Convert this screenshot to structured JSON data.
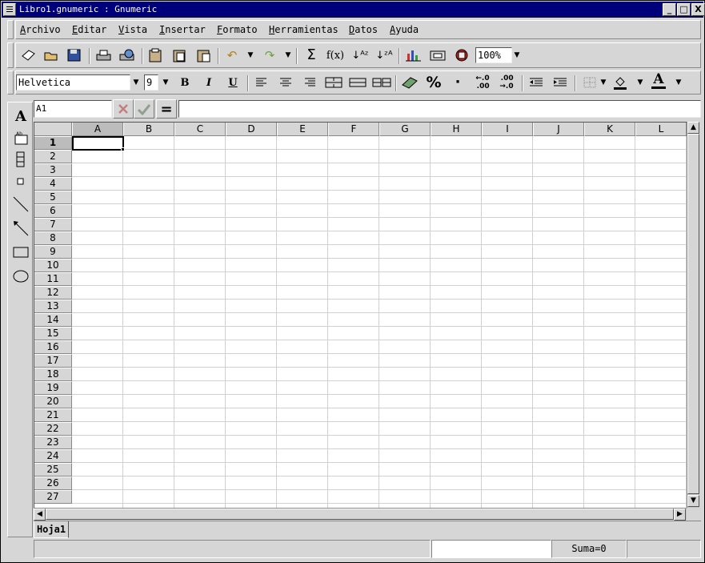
{
  "window": {
    "title": "Libro1.gnumeric : Gnumeric",
    "buttons": [
      "_",
      "□",
      "X"
    ]
  },
  "menubar": [
    {
      "label": "Archivo",
      "mnemonic": "A",
      "rest": "rchivo"
    },
    {
      "label": "Editar",
      "mnemonic": "E",
      "rest": "ditar"
    },
    {
      "label": "Vista",
      "mnemonic": "V",
      "rest": "ista"
    },
    {
      "label": "Insertar",
      "mnemonic": "I",
      "rest": "nsertar"
    },
    {
      "label": "Formato",
      "mnemonic": "F",
      "rest": "ormato"
    },
    {
      "label": "Herramientas",
      "mnemonic": "H",
      "rest": "erramientas"
    },
    {
      "label": "Datos",
      "mnemonic": "D",
      "rest": "atos"
    },
    {
      "label": "Ayuda",
      "mnemonic": "A",
      "rest": "yuda"
    }
  ],
  "standard_toolbar": {
    "zoom": "100%",
    "icons": [
      "new-icon",
      "open-icon",
      "save-icon",
      "print-icon",
      "print-preview-icon",
      "cut-icon",
      "copy-icon",
      "paste-icon",
      "undo-icon",
      "redo-icon",
      "autosum-icon",
      "function-wizard-icon",
      "sort-ascending-icon",
      "sort-descending-icon",
      "chart-icon",
      "insert-component-icon",
      "insert-shaped-icon"
    ]
  },
  "format_toolbar": {
    "font_name": "Helvetica",
    "font_size": "9",
    "bold": "B",
    "italic": "I",
    "underline": "U",
    "percent": "%",
    "thousands": "·",
    "font_color_glyph": "A"
  },
  "formula_bar": {
    "cell_ref": "A1",
    "equals": "=",
    "content": ""
  },
  "sheet": {
    "columns": [
      "A",
      "B",
      "C",
      "D",
      "E",
      "F",
      "G",
      "H",
      "I",
      "J",
      "K",
      "L"
    ],
    "rows": [
      "1",
      "2",
      "3",
      "4",
      "5",
      "6",
      "7",
      "8",
      "9",
      "10",
      "11",
      "12",
      "13",
      "14",
      "15",
      "16",
      "17",
      "18",
      "19",
      "20",
      "21",
      "22",
      "23",
      "24",
      "25",
      "26",
      "27"
    ],
    "selected_col": "A",
    "selected_row": "1"
  },
  "tabs": [
    {
      "label": "Hoja1"
    }
  ],
  "status": {
    "sum": "Suma=0"
  },
  "draw_toolbar": {
    "icons": [
      "text-tool-icon",
      "label-tool-icon",
      "frame-tool-icon",
      "checkbox-tool-icon",
      "line-tool-icon",
      "arrow-tool-icon",
      "rectangle-tool-icon",
      "ellipse-tool-icon"
    ]
  }
}
